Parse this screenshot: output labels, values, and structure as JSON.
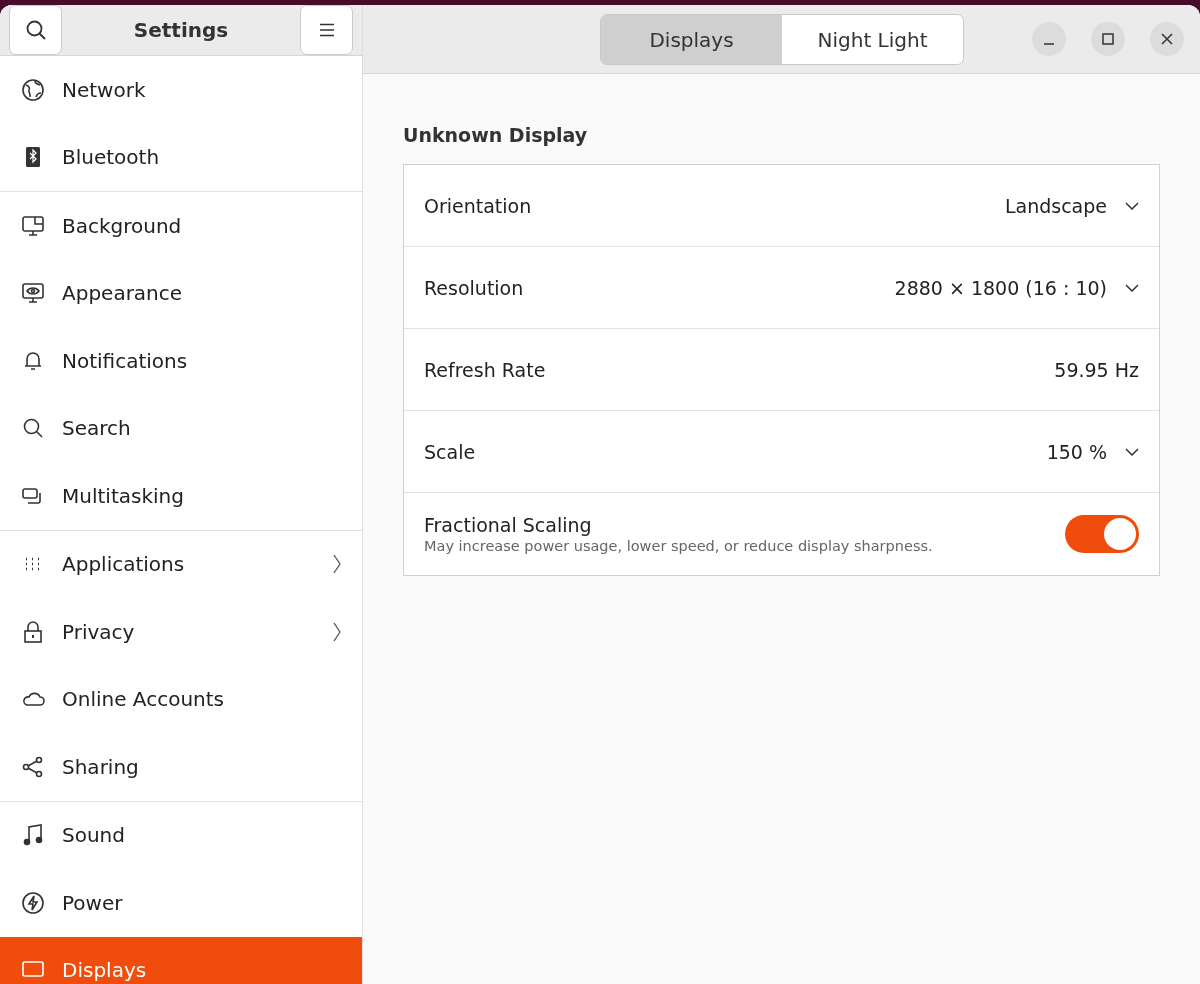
{
  "sidebar": {
    "title": "Settings",
    "groups": [
      [
        {
          "label": "Network",
          "selected": false,
          "arrow": false
        },
        {
          "label": "Bluetooth",
          "selected": false,
          "arrow": false
        }
      ],
      [
        {
          "label": "Background",
          "selected": false,
          "arrow": false
        },
        {
          "label": "Appearance",
          "selected": false,
          "arrow": false
        },
        {
          "label": "Notifications",
          "selected": false,
          "arrow": false
        },
        {
          "label": "Search",
          "selected": false,
          "arrow": false
        },
        {
          "label": "Multitasking",
          "selected": false,
          "arrow": false
        }
      ],
      [
        {
          "label": "Applications",
          "selected": false,
          "arrow": true
        },
        {
          "label": "Privacy",
          "selected": false,
          "arrow": true
        },
        {
          "label": "Online Accounts",
          "selected": false,
          "arrow": false
        },
        {
          "label": "Sharing",
          "selected": false,
          "arrow": false
        }
      ],
      [
        {
          "label": "Sound",
          "selected": false,
          "arrow": false
        },
        {
          "label": "Power",
          "selected": false,
          "arrow": false
        },
        {
          "label": "Displays",
          "selected": true,
          "arrow": false
        }
      ]
    ]
  },
  "tabs": [
    {
      "label": "Displays",
      "selected": true
    },
    {
      "label": "Night Light",
      "selected": false
    }
  ],
  "section_title": "Unknown Display",
  "rows": [
    {
      "kind": "dropdown",
      "label": "Orientation",
      "value": "Landscape"
    },
    {
      "kind": "dropdown",
      "label": "Resolution",
      "value": "2880 × 1800 (16 : 10)"
    },
    {
      "kind": "value",
      "label": "Refresh Rate",
      "value": "59.95 Hz"
    },
    {
      "kind": "dropdown",
      "label": "Scale",
      "value": "150 %"
    },
    {
      "kind": "toggle",
      "label": "Fractional Scaling",
      "subtitle": "May increase power usage, lower speed, or reduce display sharpness.",
      "on": true
    }
  ]
}
